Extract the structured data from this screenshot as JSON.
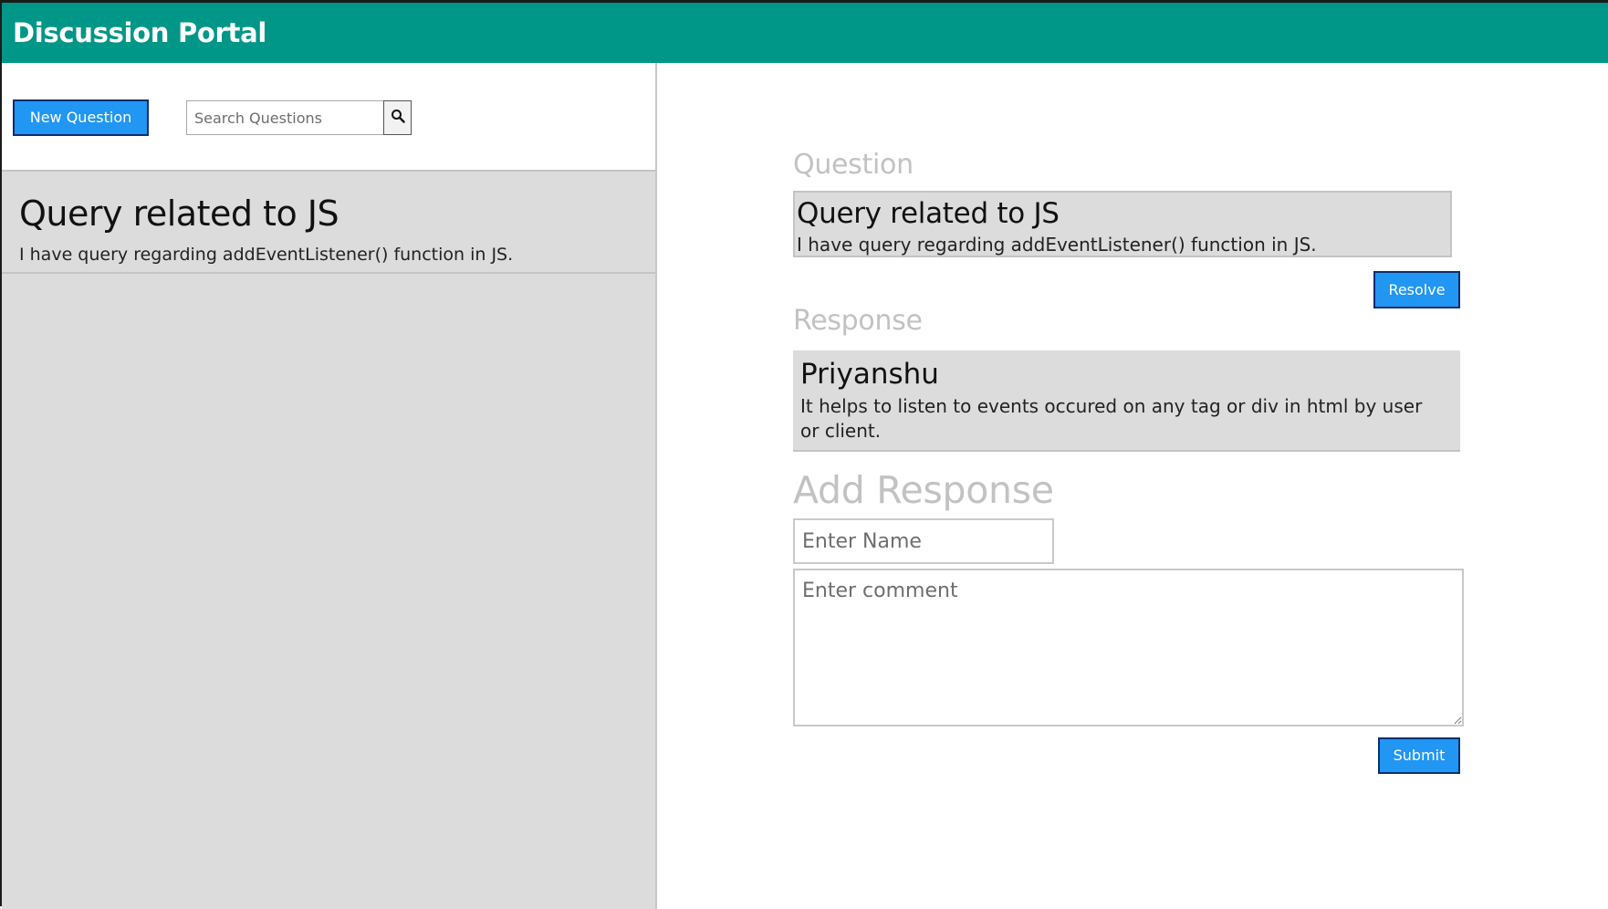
{
  "header": {
    "title": "Discussion Portal"
  },
  "left": {
    "new_question_label": "New Question",
    "search_placeholder": "Search Questions",
    "questions": [
      {
        "title": "Query related to JS",
        "description": "I have query regarding addEventListener() function in JS."
      }
    ]
  },
  "right": {
    "question_label": "Question",
    "question": {
      "title": "Query related to JS",
      "description": "I have query regarding addEventListener() function in JS."
    },
    "resolve_label": "Resolve",
    "response_label": "Response",
    "responses": [
      {
        "name": "Priyanshu",
        "comment": "It helps to listen to events occured on any tag or div in html by user or client."
      }
    ],
    "add_response_label": "Add Response",
    "name_placeholder": "Enter Name",
    "comment_placeholder": "Enter comment",
    "submit_label": "Submit"
  },
  "colors": {
    "header_bg": "#009688",
    "button_bg": "#2196f3",
    "panel_bg": "#dcdcdc",
    "label_gray": "#c2c2c2"
  },
  "icons": {
    "search": "search-icon"
  }
}
